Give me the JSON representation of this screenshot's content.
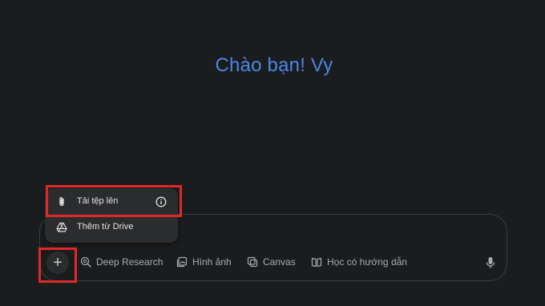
{
  "greeting": "Chào bạn! Vy",
  "upload_menu": {
    "items": [
      {
        "label": "Tải tệp lên",
        "icon": "paperclip-icon"
      },
      {
        "label": "Thêm từ Drive",
        "icon": "drive-icon"
      }
    ]
  },
  "toolbar": {
    "plus": "+",
    "tools": [
      {
        "label": "Deep Research",
        "icon": "deep-research-icon"
      },
      {
        "label": "Hình ảnh",
        "icon": "image-icon"
      },
      {
        "label": "Canvas",
        "icon": "canvas-icon"
      },
      {
        "label": "Học có hướng dẫn",
        "icon": "guided-learning-icon"
      }
    ],
    "mic_icon": "microphone-icon"
  },
  "colors": {
    "background": "#1b1c1d",
    "greeting": "#4a86e8",
    "highlight": "#e0282b",
    "menu": "#2b2c2e"
  }
}
